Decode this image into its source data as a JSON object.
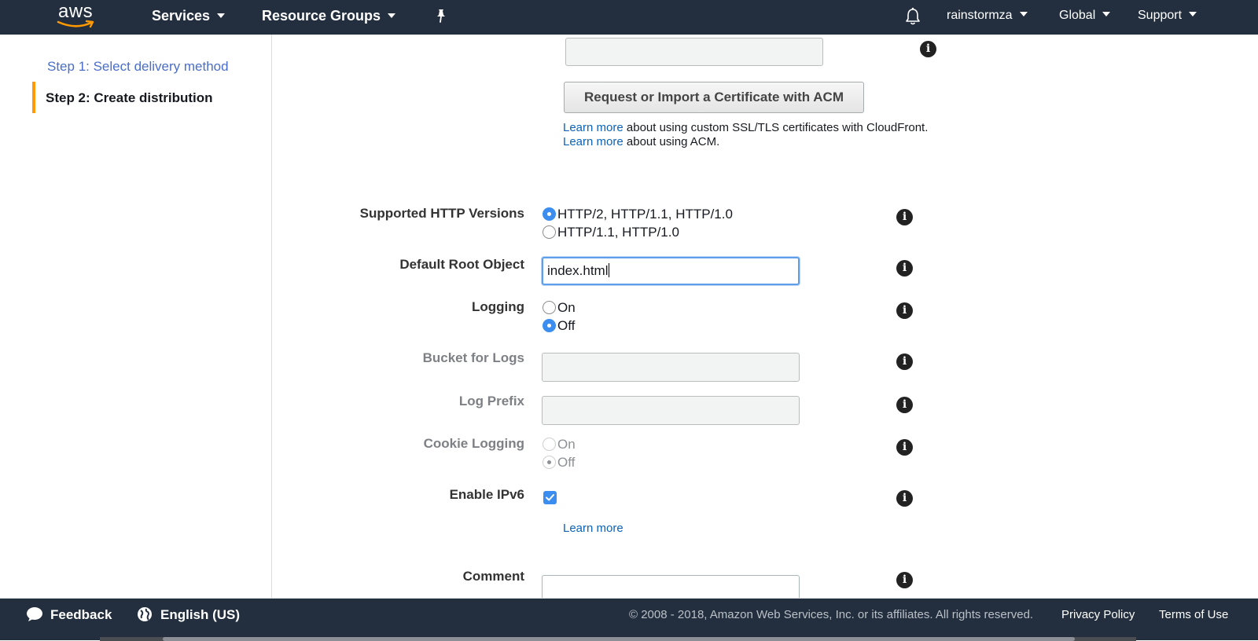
{
  "topnav": {
    "logo_text": "aws",
    "services": "Services",
    "resource_groups": "Resource Groups",
    "account": "rainstormza",
    "region": "Global",
    "support": "Support"
  },
  "sidebar": {
    "steps": [
      {
        "label": "Step 1: Select delivery method"
      },
      {
        "label": "Step 2: Create distribution"
      }
    ]
  },
  "acm": {
    "button_label": "Request or Import a Certificate with ACM",
    "learn_more_link": "Learn more",
    "note_ssl": " about using custom SSL/TLS certificates with CloudFront.",
    "note_acm": " about using ACM."
  },
  "form": {
    "http_versions": {
      "label": "Supported HTTP Versions",
      "options": [
        "HTTP/2, HTTP/1.1, HTTP/1.0",
        "HTTP/1.1, HTTP/1.0"
      ],
      "selected": 0
    },
    "default_root_object": {
      "label": "Default Root Object",
      "value": "index.html"
    },
    "logging": {
      "label": "Logging",
      "options": [
        "On",
        "Off"
      ],
      "selected": 1
    },
    "bucket_for_logs": {
      "label": "Bucket for Logs",
      "value": ""
    },
    "log_prefix": {
      "label": "Log Prefix",
      "value": ""
    },
    "cookie_logging": {
      "label": "Cookie Logging",
      "options": [
        "On",
        "Off"
      ],
      "selected": 1,
      "disabled": true
    },
    "enable_ipv6": {
      "label": "Enable IPv6",
      "checked": true,
      "learn_more": "Learn more"
    },
    "comment": {
      "label": "Comment",
      "value": ""
    }
  },
  "footer": {
    "feedback": "Feedback",
    "language": "English (US)",
    "copyright": "© 2008 - 2018, Amazon Web Services, Inc. or its affiliates. All rights reserved.",
    "privacy": "Privacy Policy",
    "terms": "Terms of Use"
  },
  "colors": {
    "nav_bg": "#232f3e",
    "accent_orange": "#ff9900",
    "link_blue": "#0b63b8",
    "radio_blue": "#3b8ef0"
  }
}
